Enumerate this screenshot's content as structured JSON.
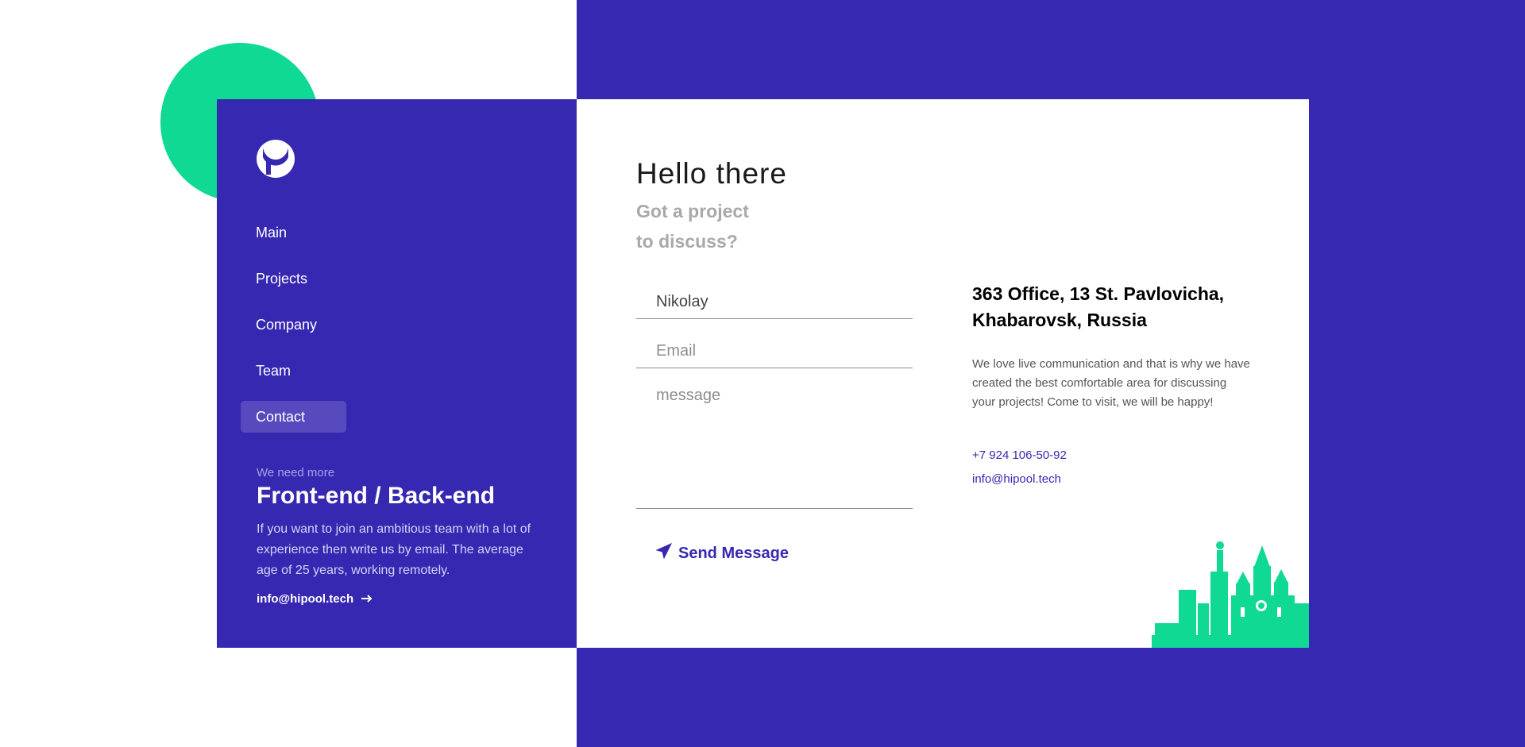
{
  "colors": {
    "primary": "#3728b2",
    "accent": "#0fd993",
    "white": "#ffffff"
  },
  "sidebar": {
    "logo_icon": "hipool-logo-icon",
    "nav": [
      "Main",
      "Projects",
      "Company",
      "Team",
      "Contact"
    ],
    "active_item": "Contact",
    "hiring": {
      "small": "We need more",
      "title": "Front-end / Back-end",
      "text": "If you want to join an ambitious team with a lot of experience then write us by email. The average age of 25 years, working remotely.",
      "email": "info@hipool.tech",
      "arrow_icon": "arrow-right-icon"
    }
  },
  "contact": {
    "title": "Hello there",
    "subtitle_line1": "Got a project",
    "subtitle_line2": "to discuss?",
    "name_value": "Nikolay",
    "email_placeholder": "Email",
    "message_placeholder": "message",
    "send_label": "Send Message",
    "send_icon": "paper-plane-icon"
  },
  "info": {
    "address_line1": "363 Office, 13 St. Pavlovicha,",
    "address_line2": "Khabarovsk, Russia",
    "description": "We love live communication and that is why we have created the best comfortable area for discussing your projects! Come to visit, we will be happy!",
    "phone": "+7 924 106-50-92",
    "email": "info@hipool.tech",
    "skyline_icon": "city-skyline-icon"
  }
}
